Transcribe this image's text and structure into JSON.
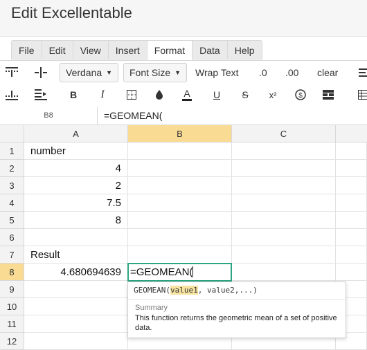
{
  "app": {
    "title": "Edit Excellentable"
  },
  "menu_tabs": [
    "File",
    "Edit",
    "View",
    "Insert",
    "Format",
    "Data",
    "Help"
  ],
  "active_tab": "Format",
  "toolbar": {
    "font": "Verdana",
    "font_size": "Font Size",
    "wrap_text": "Wrap Text",
    "dec_less": ".0",
    "dec_more": ".00",
    "clear": "clear",
    "bold": "B",
    "italic": "I",
    "text_color": "A",
    "underline": "U",
    "strike": "S",
    "superscript": "x²"
  },
  "formula_bar": {
    "cell_ref": "B8",
    "value": "=GEOMEAN("
  },
  "columns": [
    "A",
    "B",
    "C"
  ],
  "rows": [
    "1",
    "2",
    "3",
    "4",
    "5",
    "6",
    "7",
    "8",
    "9",
    "10",
    "11",
    "12"
  ],
  "cells": {
    "A1": "number",
    "A2": "4",
    "A3": "2",
    "A4": "7.5",
    "A5": "8",
    "A7": "Result",
    "A8": "4.680694639",
    "B8": "=GEOMEAN("
  },
  "tooltip": {
    "sig_prefix": "GEOMEAN(",
    "sig_arg1": "value1",
    "sig_rest": ", value2,...)",
    "summary_heading": "Summary",
    "summary_text": "This function returns the geometric mean of a set of positive data."
  },
  "colors": {
    "selection_header": "#f9db93",
    "editor_border": "#2ba581"
  }
}
